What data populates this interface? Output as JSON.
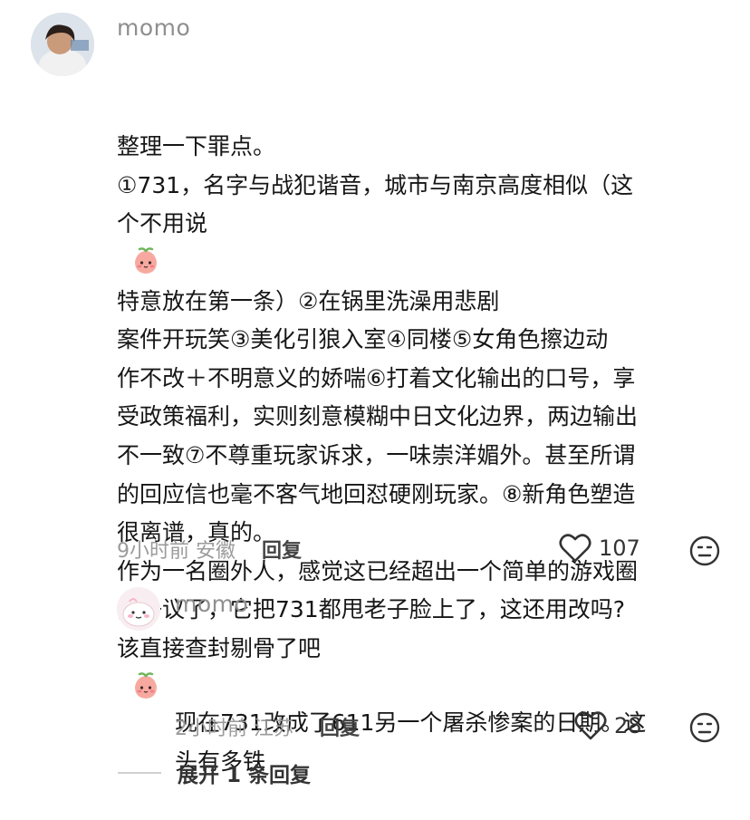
{
  "main_comment": {
    "username": "momo",
    "lines": [
      "整理一下罪点。",
      "①731，名字与战犯谐音，城市与南京高度相似（这",
      "个不用说[emoji]特意放在第一条）②在锅里洗澡用悲剧",
      "案件开玩笑③美化引狼入室④同楼⑤女角色擦边动",
      "作不改＋不明意义的娇喘⑥打着文化输出的口号，享",
      "受政策福利，实则刻意模糊中日文化边界，两边输出",
      "不一致⑦不尊重玩家诉求，一味崇洋媚外。甚至所谓",
      "的回应信也毫不客气地回怼硬刚玩家。⑧新角色塑造",
      "很离谱，真的。",
      "作为一名圈外人，感觉这已经超出一个简单的游戏圈",
      "内争议了，它把731都甩老子脸上了，这还用改吗?",
      "该直接查封剔骨了吧[emoji]"
    ],
    "time": "9小时前",
    "location": "安徽",
    "reply_label": "回复",
    "like_count": "107"
  },
  "reply_comment": {
    "username": "momo",
    "lines": [
      "现在731改成了611另一个屠杀惨案的日期。这",
      "头有多铁"
    ],
    "time": "2小时前",
    "location": "江苏",
    "reply_label": "回复",
    "like_count": "28"
  },
  "expand_label": "展开 1 条回复",
  "icons": {
    "like": "heart-outline-icon",
    "dislike": "dislike-face-icon",
    "emoji": "peach-face-emoji"
  }
}
